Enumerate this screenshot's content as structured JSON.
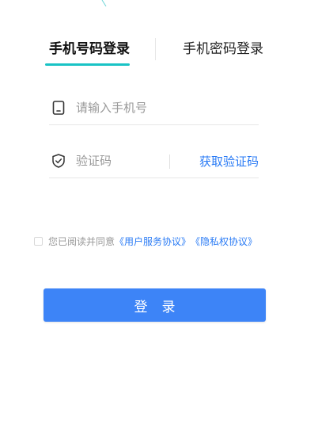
{
  "tabs": [
    {
      "label": "手机号码登录",
      "active": true
    },
    {
      "label": "手机密码登录",
      "active": false
    }
  ],
  "phone_field": {
    "placeholder": "请输入手机号",
    "value": "",
    "icon": "phone-icon"
  },
  "code_field": {
    "placeholder": "验证码",
    "value": "",
    "icon": "shield-check-icon",
    "get_code_label": "获取验证码"
  },
  "agreement": {
    "checked": false,
    "prefix": "您已阅读并同意",
    "user_agreement_link": "《用户服务协议》",
    "privacy_link": "《隐私权协议》"
  },
  "login_button": {
    "label": "登录"
  },
  "colors": {
    "accent_tab": "#19c3c5",
    "link": "#2a7bf5",
    "button": "#3d84f7"
  }
}
